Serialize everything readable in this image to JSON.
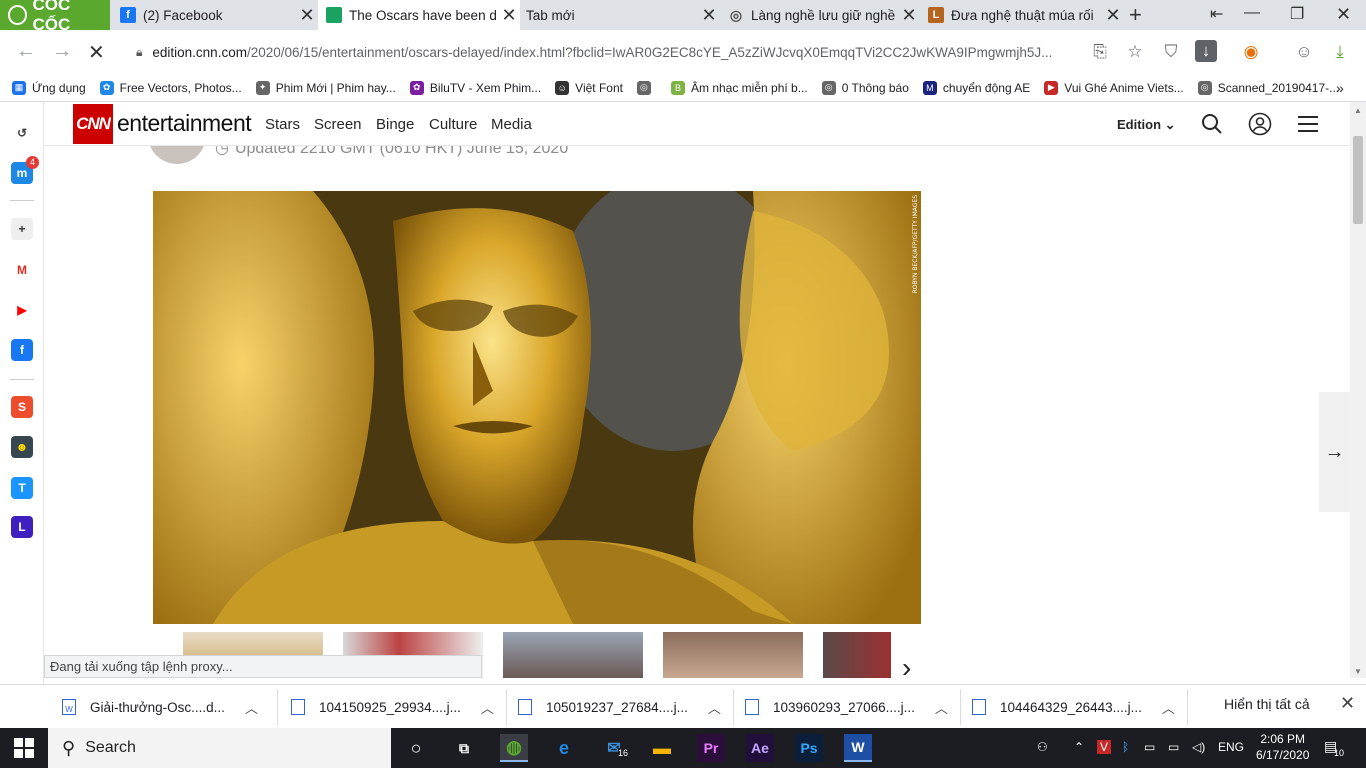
{
  "browser": {
    "brand": "CỐC CỐC",
    "tabs": [
      {
        "title": "(2) Facebook",
        "icon": "facebook-icon",
        "color": "#1877f2",
        "glyph": "f"
      },
      {
        "title": "The Oscars have been d",
        "icon": "cnn-page-icon",
        "color": "#1aa260",
        "glyph": ""
      },
      {
        "title": "Tab mới",
        "icon": "",
        "color": "",
        "glyph": ""
      },
      {
        "title": "Làng nghề lưu giữ nghề",
        "icon": "globe-icon",
        "color": "#555555",
        "glyph": "◎"
      },
      {
        "title": "Đưa nghệ thuật múa rối",
        "icon": "site-icon",
        "color": "#b5651d",
        "glyph": "L"
      }
    ],
    "url_host": "edition.cnn.com",
    "url_path": "/2020/06/15/entertainment/oscars-delayed/index.html?fbclid=IwAR0G2EC8cYE_A5zZiWJcvqX0EmqqTVi2CC2JwKWA9IPmgwmjh5J...",
    "bookmarks": [
      {
        "label": "Ứng dụng",
        "color": "#1a73e8",
        "glyph": "▦"
      },
      {
        "label": "Free Vectors, Photos...",
        "color": "#1e88e5",
        "glyph": "✿"
      },
      {
        "label": "Phim Mới | Phim hay...",
        "color": "#666666",
        "glyph": "✦"
      },
      {
        "label": "BiluTV - Xem Phim...",
        "color": "#7b1fa2",
        "glyph": "✿"
      },
      {
        "label": "Việt Font",
        "color": "#333333",
        "glyph": "☺"
      },
      {
        "label": "",
        "color": "#666666",
        "glyph": "◎"
      },
      {
        "label": "Âm nhạc miễn phí b...",
        "color": "#7cb342",
        "glyph": "B"
      },
      {
        "label": "0 Thông báo",
        "color": "#666666",
        "glyph": "◎"
      },
      {
        "label": "chuyển động AE",
        "color": "#1a237e",
        "glyph": "M"
      },
      {
        "label": "Vui Ghé Anime Viets...",
        "color": "#c62828",
        "glyph": "▶"
      },
      {
        "label": "Scanned_20190417-...",
        "color": "#666666",
        "glyph": "◎"
      }
    ],
    "more_bookmarks": "»"
  },
  "sidebar": {
    "messenger_badge": "4",
    "apps": [
      {
        "name": "history-icon",
        "color": "#ffffff",
        "glyph": "↺",
        "fg": "#444444"
      },
      {
        "name": "messenger-icon",
        "color": "#1e88e5",
        "glyph": "m",
        "fg": "#ffffff"
      },
      {
        "name": "add-app-icon",
        "color": "#eeeeee",
        "glyph": "+",
        "fg": "#333333"
      },
      {
        "name": "gmail-icon",
        "color": "#ffffff",
        "glyph": "M",
        "fg": "#d93025"
      },
      {
        "name": "youtube-icon",
        "color": "#ffffff",
        "glyph": "▶",
        "fg": "#ff0000"
      },
      {
        "name": "facebook-icon",
        "color": "#1877f2",
        "glyph": "f",
        "fg": "#ffffff"
      },
      {
        "name": "shopee-icon",
        "color": "#ee4d2d",
        "glyph": "S",
        "fg": "#ffffff"
      },
      {
        "name": "game-icon",
        "color": "#37474f",
        "glyph": "☻",
        "fg": "#ffd600"
      },
      {
        "name": "tiki-icon",
        "color": "#1a94ff",
        "glyph": "T",
        "fg": "#ffffff"
      },
      {
        "name": "lazada-icon",
        "color": "#3f1fbf",
        "glyph": "L",
        "fg": "#ffffff"
      }
    ],
    "more": "•••"
  },
  "page": {
    "logo": "CNN",
    "section": "entertainment",
    "menu": [
      "Stars",
      "Screen",
      "Binge",
      "Culture",
      "Media"
    ],
    "edition": "Edition",
    "byline": "Updated 2210 GMT (0610 HKT) June 15, 2020",
    "photo_credit": "ROBYN BECK/AFP/GETTY IMAGES",
    "status": "Đang tải xuống tập lệnh proxy..."
  },
  "downloads": [
    {
      "name": "Giải-thưởng-Osc....d...",
      "type": "W"
    },
    {
      "name": "104150925_29934....j...",
      "type": ""
    },
    {
      "name": "105019237_27684....j...",
      "type": ""
    },
    {
      "name": "103960293_27066....j...",
      "type": ""
    },
    {
      "name": "104464329_26443....j...",
      "type": ""
    }
  ],
  "show_all": "Hiển thị tất cả",
  "taskbar": {
    "search": "Search",
    "mail_badge": "16",
    "lang": "ENG",
    "time": "2:06 PM",
    "date": "6/17/2020",
    "notif_count": "10"
  }
}
